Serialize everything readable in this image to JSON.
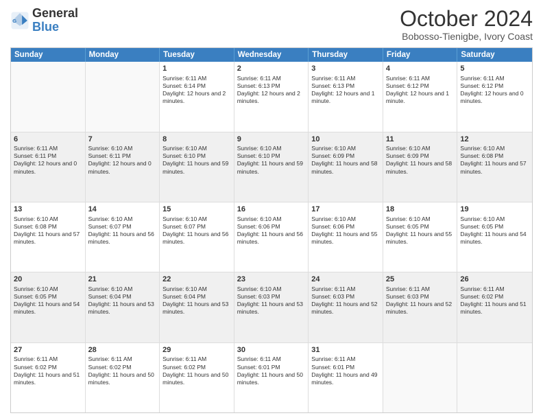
{
  "logo": {
    "line1": "General",
    "line2": "Blue"
  },
  "title": "October 2024",
  "subtitle": "Bobosso-Tienigbe, Ivory Coast",
  "header_days": [
    "Sunday",
    "Monday",
    "Tuesday",
    "Wednesday",
    "Thursday",
    "Friday",
    "Saturday"
  ],
  "weeks": [
    [
      {
        "day": "",
        "info": ""
      },
      {
        "day": "",
        "info": ""
      },
      {
        "day": "1",
        "info": "Sunrise: 6:11 AM\nSunset: 6:14 PM\nDaylight: 12 hours and 2 minutes."
      },
      {
        "day": "2",
        "info": "Sunrise: 6:11 AM\nSunset: 6:13 PM\nDaylight: 12 hours and 2 minutes."
      },
      {
        "day": "3",
        "info": "Sunrise: 6:11 AM\nSunset: 6:13 PM\nDaylight: 12 hours and 1 minute."
      },
      {
        "day": "4",
        "info": "Sunrise: 6:11 AM\nSunset: 6:12 PM\nDaylight: 12 hours and 1 minute."
      },
      {
        "day": "5",
        "info": "Sunrise: 6:11 AM\nSunset: 6:12 PM\nDaylight: 12 hours and 0 minutes."
      }
    ],
    [
      {
        "day": "6",
        "info": "Sunrise: 6:11 AM\nSunset: 6:11 PM\nDaylight: 12 hours and 0 minutes."
      },
      {
        "day": "7",
        "info": "Sunrise: 6:10 AM\nSunset: 6:11 PM\nDaylight: 12 hours and 0 minutes."
      },
      {
        "day": "8",
        "info": "Sunrise: 6:10 AM\nSunset: 6:10 PM\nDaylight: 11 hours and 59 minutes."
      },
      {
        "day": "9",
        "info": "Sunrise: 6:10 AM\nSunset: 6:10 PM\nDaylight: 11 hours and 59 minutes."
      },
      {
        "day": "10",
        "info": "Sunrise: 6:10 AM\nSunset: 6:09 PM\nDaylight: 11 hours and 58 minutes."
      },
      {
        "day": "11",
        "info": "Sunrise: 6:10 AM\nSunset: 6:09 PM\nDaylight: 11 hours and 58 minutes."
      },
      {
        "day": "12",
        "info": "Sunrise: 6:10 AM\nSunset: 6:08 PM\nDaylight: 11 hours and 57 minutes."
      }
    ],
    [
      {
        "day": "13",
        "info": "Sunrise: 6:10 AM\nSunset: 6:08 PM\nDaylight: 11 hours and 57 minutes."
      },
      {
        "day": "14",
        "info": "Sunrise: 6:10 AM\nSunset: 6:07 PM\nDaylight: 11 hours and 56 minutes."
      },
      {
        "day": "15",
        "info": "Sunrise: 6:10 AM\nSunset: 6:07 PM\nDaylight: 11 hours and 56 minutes."
      },
      {
        "day": "16",
        "info": "Sunrise: 6:10 AM\nSunset: 6:06 PM\nDaylight: 11 hours and 56 minutes."
      },
      {
        "day": "17",
        "info": "Sunrise: 6:10 AM\nSunset: 6:06 PM\nDaylight: 11 hours and 55 minutes."
      },
      {
        "day": "18",
        "info": "Sunrise: 6:10 AM\nSunset: 6:05 PM\nDaylight: 11 hours and 55 minutes."
      },
      {
        "day": "19",
        "info": "Sunrise: 6:10 AM\nSunset: 6:05 PM\nDaylight: 11 hours and 54 minutes."
      }
    ],
    [
      {
        "day": "20",
        "info": "Sunrise: 6:10 AM\nSunset: 6:05 PM\nDaylight: 11 hours and 54 minutes."
      },
      {
        "day": "21",
        "info": "Sunrise: 6:10 AM\nSunset: 6:04 PM\nDaylight: 11 hours and 53 minutes."
      },
      {
        "day": "22",
        "info": "Sunrise: 6:10 AM\nSunset: 6:04 PM\nDaylight: 11 hours and 53 minutes."
      },
      {
        "day": "23",
        "info": "Sunrise: 6:10 AM\nSunset: 6:03 PM\nDaylight: 11 hours and 53 minutes."
      },
      {
        "day": "24",
        "info": "Sunrise: 6:11 AM\nSunset: 6:03 PM\nDaylight: 11 hours and 52 minutes."
      },
      {
        "day": "25",
        "info": "Sunrise: 6:11 AM\nSunset: 6:03 PM\nDaylight: 11 hours and 52 minutes."
      },
      {
        "day": "26",
        "info": "Sunrise: 6:11 AM\nSunset: 6:02 PM\nDaylight: 11 hours and 51 minutes."
      }
    ],
    [
      {
        "day": "27",
        "info": "Sunrise: 6:11 AM\nSunset: 6:02 PM\nDaylight: 11 hours and 51 minutes."
      },
      {
        "day": "28",
        "info": "Sunrise: 6:11 AM\nSunset: 6:02 PM\nDaylight: 11 hours and 50 minutes."
      },
      {
        "day": "29",
        "info": "Sunrise: 6:11 AM\nSunset: 6:02 PM\nDaylight: 11 hours and 50 minutes."
      },
      {
        "day": "30",
        "info": "Sunrise: 6:11 AM\nSunset: 6:01 PM\nDaylight: 11 hours and 50 minutes."
      },
      {
        "day": "31",
        "info": "Sunrise: 6:11 AM\nSunset: 6:01 PM\nDaylight: 11 hours and 49 minutes."
      },
      {
        "day": "",
        "info": ""
      },
      {
        "day": "",
        "info": ""
      }
    ]
  ]
}
